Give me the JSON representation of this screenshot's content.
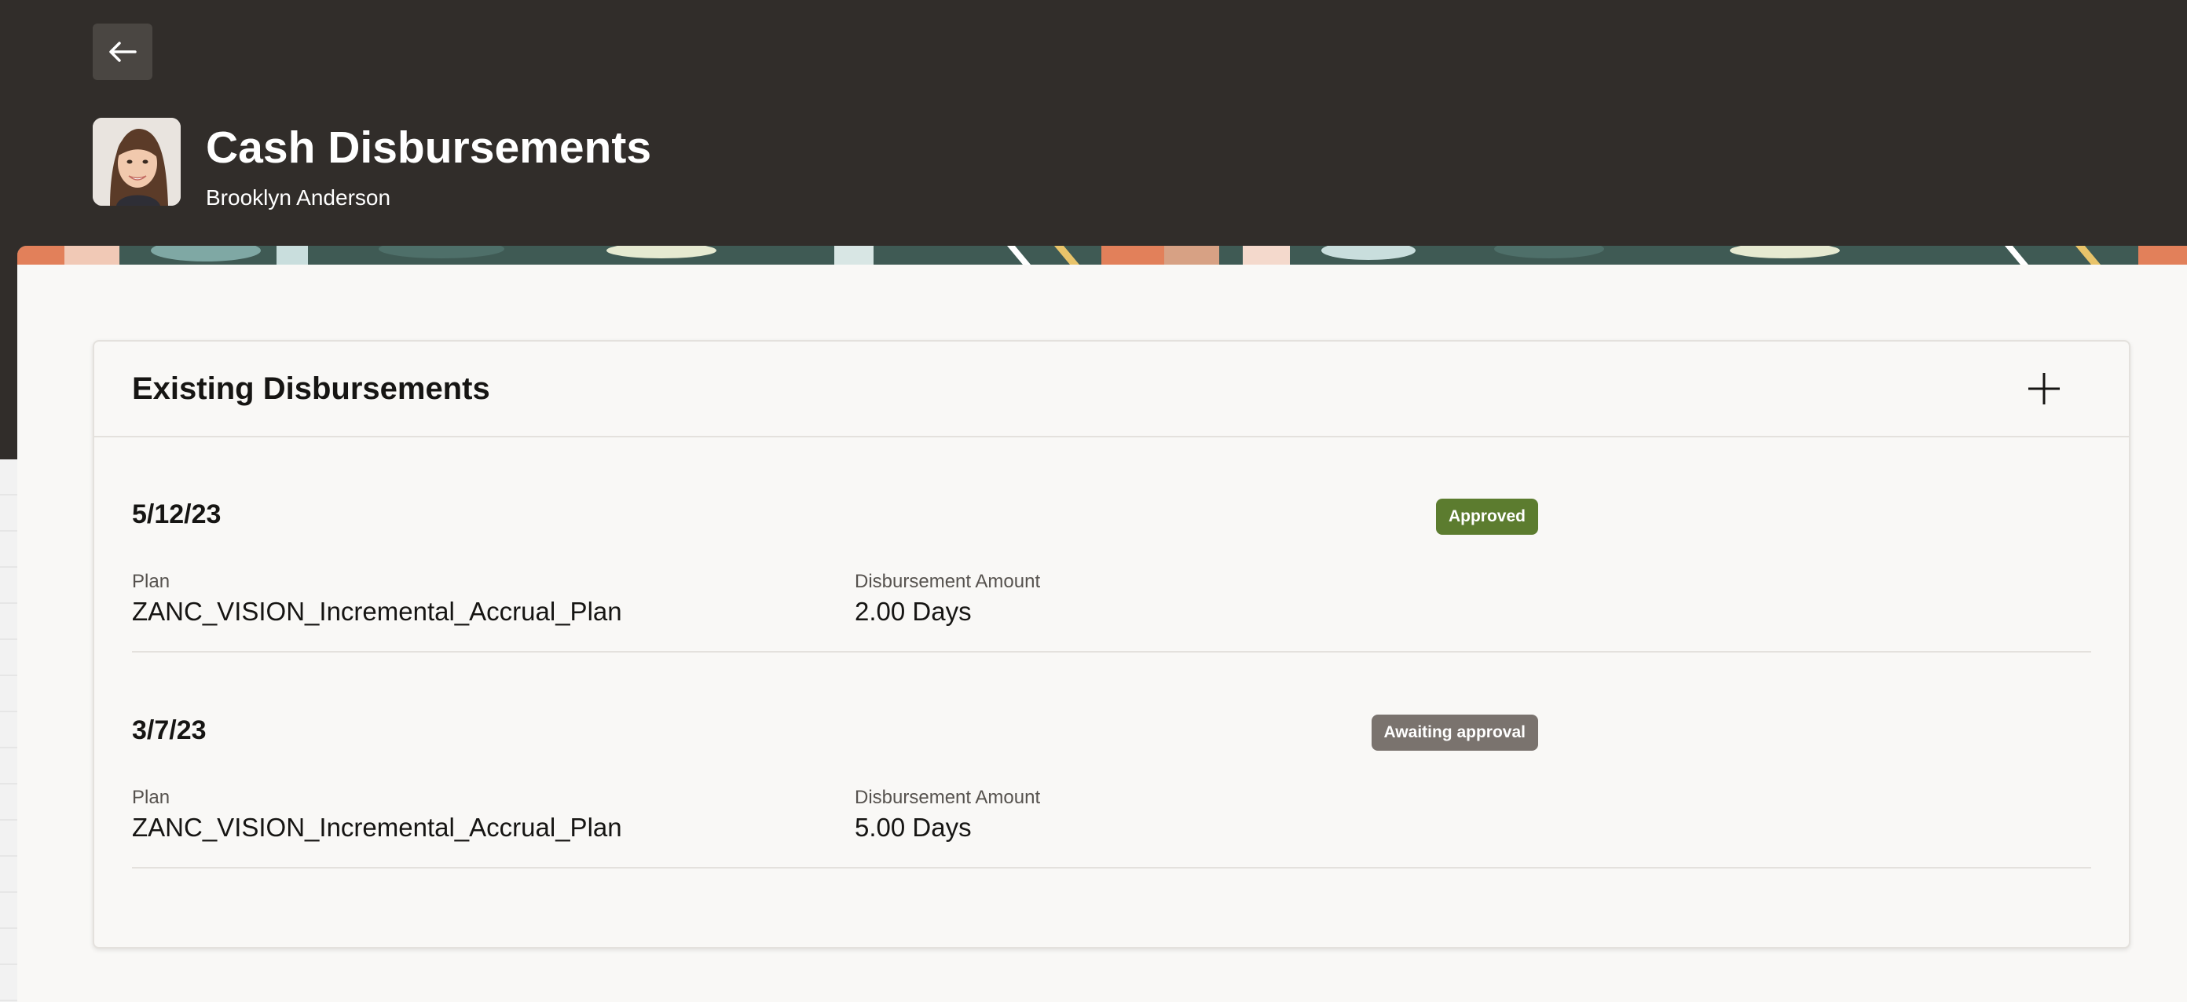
{
  "header": {
    "title": "Cash Disbursements",
    "subtitle": "Brooklyn Anderson",
    "back_icon": "arrow-left-icon",
    "background_color": "#312d2a"
  },
  "card": {
    "title": "Existing Disbursements",
    "add_icon": "plus-icon"
  },
  "disbursements": [
    {
      "date": "5/12/23",
      "status": "Approved",
      "status_color": "#5c7c2f",
      "plan_label": "Plan",
      "plan_value": "ZANC_VISION_Incremental_Accrual_Plan",
      "amount_label": "Disbursement Amount",
      "amount_value": "2.00 Days"
    },
    {
      "date": "3/7/23",
      "status": "Awaiting approval",
      "status_color": "#7a736e",
      "plan_label": "Plan",
      "plan_value": "ZANC_VISION_Incremental_Accrual_Plan",
      "amount_label": "Disbursement Amount",
      "amount_value": "5.00 Days"
    }
  ]
}
